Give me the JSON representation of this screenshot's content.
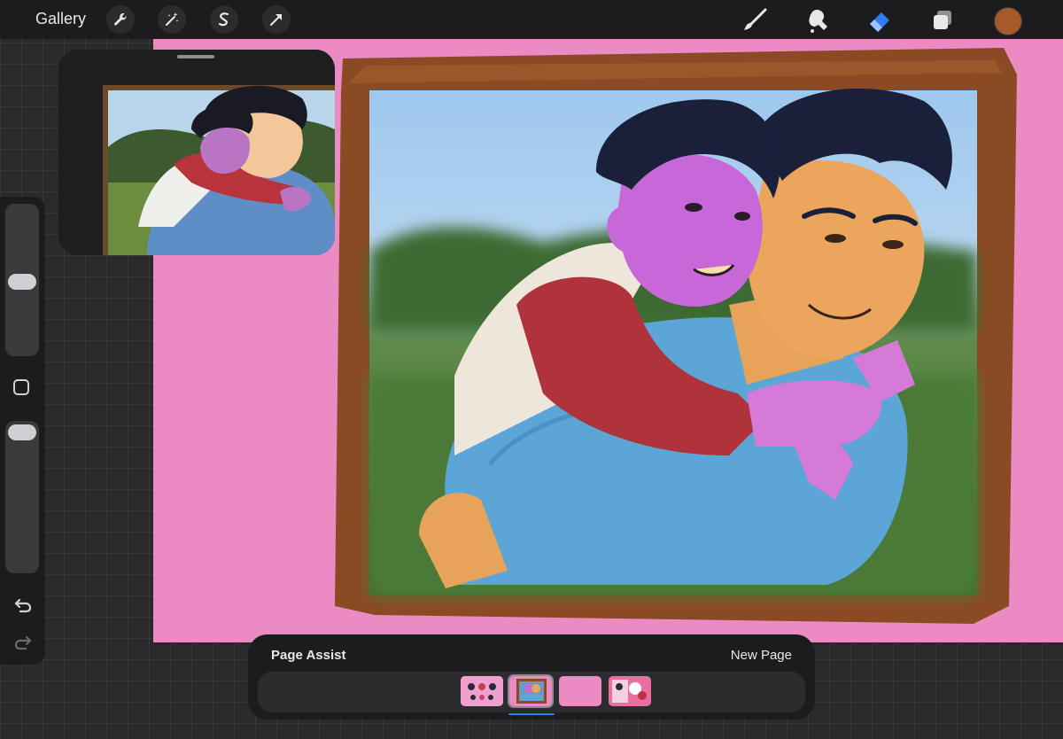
{
  "topbar": {
    "gallery_label": "Gallery",
    "left_tools": [
      "wrench-icon",
      "magic-wand-icon",
      "selection-icon",
      "transform-arrow-icon"
    ],
    "right_tools": [
      "brush-icon",
      "smudge-icon",
      "eraser-icon",
      "layers-icon"
    ],
    "active_tool": "eraser-icon",
    "current_color": "#a65a2a"
  },
  "page_assist": {
    "title": "Page Assist",
    "new_page_label": "New Page",
    "pages": [
      "page-1",
      "page-2",
      "page-3",
      "page-4"
    ],
    "selected_page": "page-2"
  },
  "colors": {
    "canvas_background": "#ec8ac4",
    "frame_brown": "#8a4a24",
    "accent_blue": "#2f7cf6"
  }
}
